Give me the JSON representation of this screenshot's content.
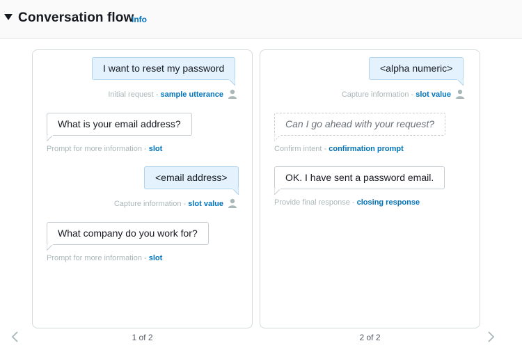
{
  "header": {
    "title": "Conversation flow",
    "info_label": "Info"
  },
  "cards": [
    {
      "pager": "1 of 2",
      "messages": [
        {
          "role": "user",
          "text": "I want to reset my password",
          "caption_prefix": "Initial request - ",
          "caption_link": "sample utterance"
        },
        {
          "role": "bot",
          "text": "What is your email address?",
          "caption_prefix": "Prompt for more information - ",
          "caption_link": "slot"
        },
        {
          "role": "user",
          "text": "<email address>",
          "caption_prefix": "Capture information - ",
          "caption_link": "slot value"
        },
        {
          "role": "bot",
          "text": "What company do you work for?",
          "caption_prefix": "Prompt for more information - ",
          "caption_link": "slot"
        }
      ]
    },
    {
      "pager": "2 of 2",
      "messages": [
        {
          "role": "user",
          "text": "<alpha numeric>",
          "caption_prefix": "Capture information - ",
          "caption_link": "slot value"
        },
        {
          "role": "bot-dashed",
          "text": "Can I go ahead with your request?",
          "caption_prefix": "Confirm intent - ",
          "caption_link": "confirmation prompt"
        },
        {
          "role": "bot",
          "text": "OK. I have sent a password email.",
          "caption_prefix": "Provide final response - ",
          "caption_link": "closing response"
        }
      ]
    }
  ],
  "icons": {
    "user_icon": "person-icon",
    "prev": "chevron-left-icon",
    "next": "chevron-right-icon"
  },
  "colors": {
    "accent": "#0073bb",
    "user_bubble": "#e3f2fd",
    "caption": "#aab7b8"
  }
}
